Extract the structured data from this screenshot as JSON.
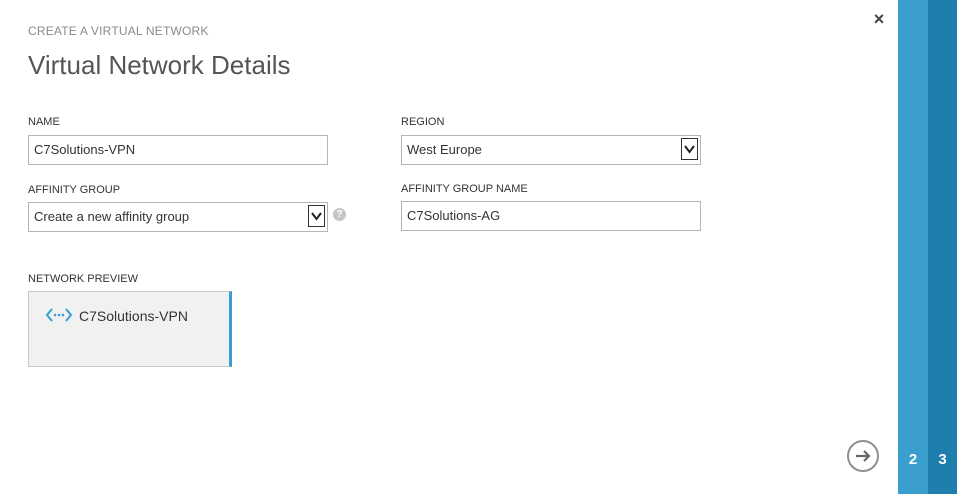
{
  "wizard": {
    "subtitle": "CREATE A VIRTUAL NETWORK",
    "title": "Virtual Network Details",
    "close_label": "×"
  },
  "form": {
    "name_label": "NAME",
    "name_value": "C7Solutions-VPN",
    "region_label": "REGION",
    "region_value": "West Europe",
    "affinity_group_label": "AFFINITY GROUP",
    "affinity_group_value": "Create a new affinity group",
    "help_icon_glyph": "?",
    "affinity_group_name_label": "AFFINITY GROUP NAME",
    "affinity_group_name_value": "C7Solutions-AG"
  },
  "preview": {
    "label": "NETWORK PREVIEW",
    "network_name": "C7Solutions-VPN",
    "icon": "virtual-network-icon"
  },
  "nav": {
    "next_icon": "arrow-right-icon",
    "steps": [
      "2",
      "3"
    ]
  },
  "colors": {
    "accent": "#3a9bd5",
    "step2": "#3a9fcf",
    "step3": "#1e7fae"
  }
}
